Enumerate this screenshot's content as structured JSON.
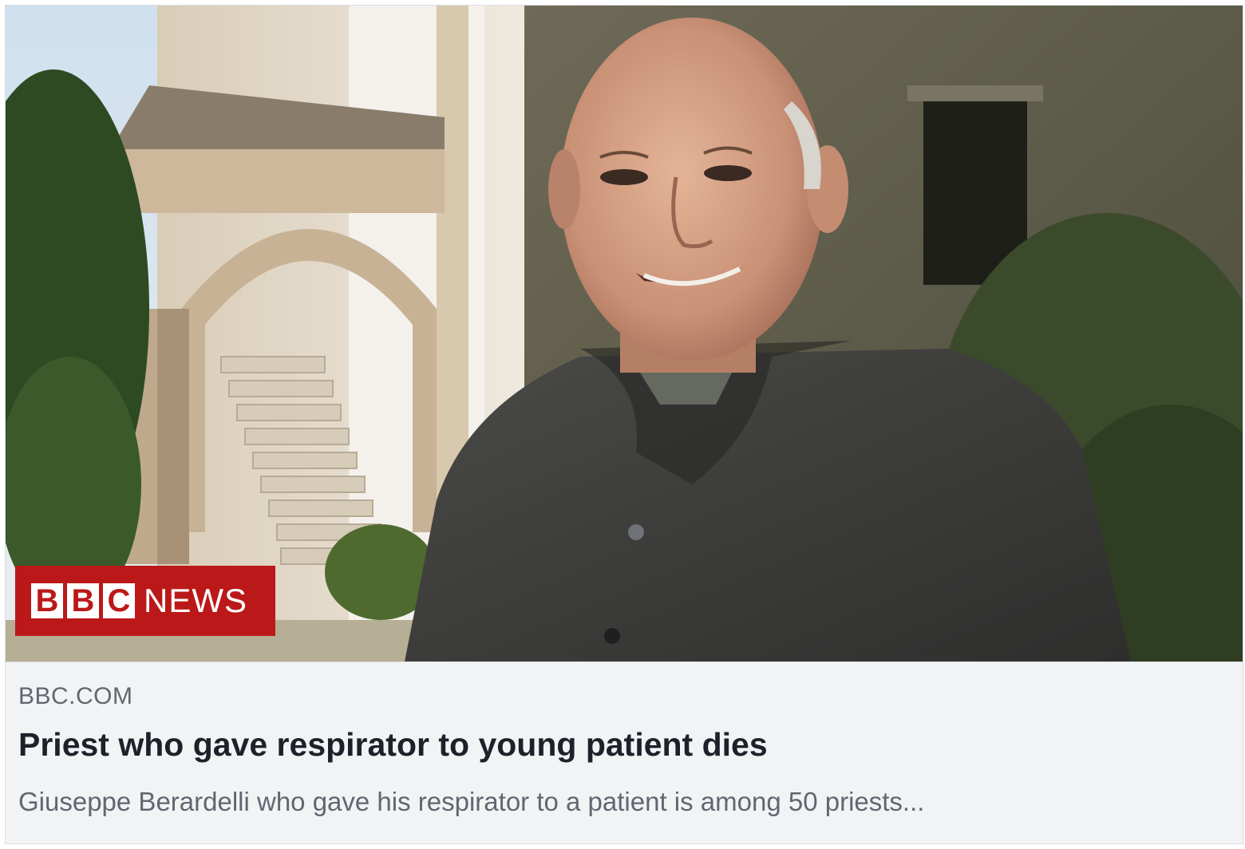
{
  "link_card": {
    "image": {
      "description_icon": "priest-photo",
      "badge": {
        "letters": [
          "B",
          "B",
          "C"
        ],
        "label": "NEWS"
      }
    },
    "domain": "BBC.COM",
    "headline": "Priest who gave respirator to young patient dies",
    "description": "Giuseppe Berardelli who gave his respirator to a patient is among 50 priests..."
  },
  "colors": {
    "bbc_red": "#bb1919",
    "card_bg": "#f2f3f5",
    "headline": "#1d2129",
    "secondary_text": "#606770"
  }
}
